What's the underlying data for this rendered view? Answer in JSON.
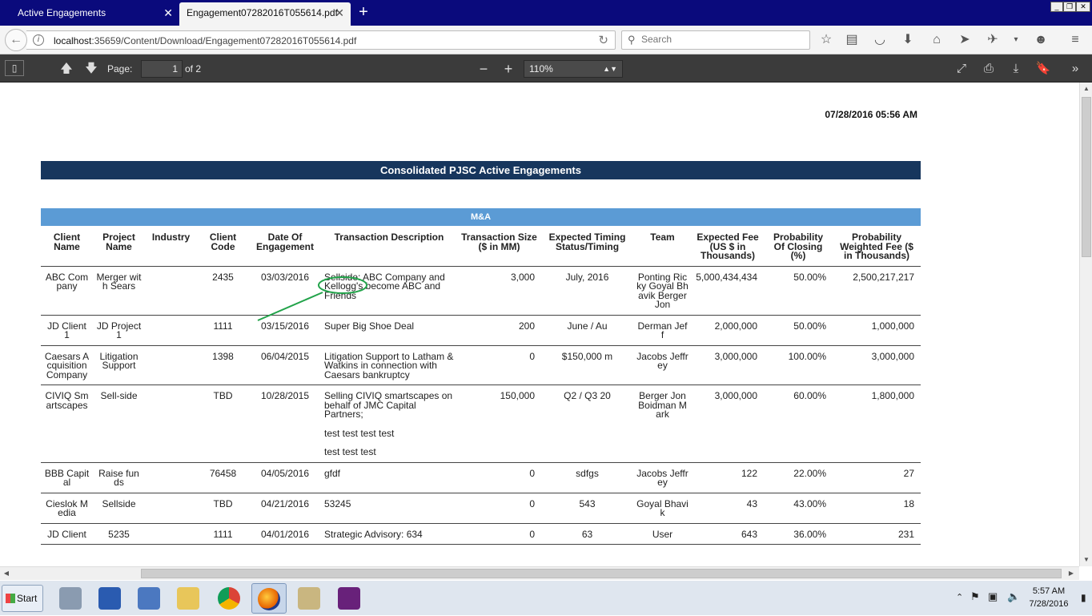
{
  "browser": {
    "tabs": [
      {
        "label": "Active Engagements",
        "active": false
      },
      {
        "label": "Engagement07282016T055614.pdf",
        "active": true
      }
    ],
    "url_host": "localhost",
    "url_rest": ":35659/Content/Download/Engagement07282016T055614.pdf",
    "search_placeholder": "Search"
  },
  "pdf_toolbar": {
    "page_label": "Page:",
    "page_value": "1",
    "page_count": "of 2",
    "zoom": "110%"
  },
  "report": {
    "timestamp": "07/28/2016 05:56 AM",
    "title": "Consolidated PJSC Active Engagements",
    "section": "M&A",
    "columns": [
      "Client Name",
      "Project Name",
      "Industry",
      "Client Code",
      "Date Of Engagement",
      "Transaction Description",
      "Transaction Size ($ in MM)",
      "Expected Timing Status/Timing",
      "Team",
      "Expected Fee (US $ in Thousands)",
      "Probability Of Closing (%)",
      "Probability Weighted Fee ($ in Thousands)"
    ],
    "rows": [
      {
        "client": "ABC Company",
        "project": "Merger with Sears",
        "industry": "",
        "code": "2435",
        "date": "03/03/2016",
        "desc": [
          "Sellside: ABC Company and Kellogg's become ABC and Friends"
        ],
        "size": "3,000",
        "timing": "July, 2016",
        "team": "Ponting Ricky Goyal Bhavik Berger Jon",
        "fee": "5,000,434,434",
        "prob": "50.00%",
        "weighted": "2,500,217,217"
      },
      {
        "client": "JD Client 1",
        "project": "JD Project 1",
        "industry": "",
        "code": "1111",
        "date": "03/15/2016",
        "desc": [
          "Super Big Shoe Deal"
        ],
        "size": "200",
        "timing": "June  / Au",
        "team": "Derman Jeff",
        "fee": "2,000,000",
        "prob": "50.00%",
        "weighted": "1,000,000"
      },
      {
        "client": "Caesars Acquisition Company",
        "project": "Litigation Support",
        "industry": "",
        "code": "1398",
        "date": "06/04/2015",
        "desc": [
          "Litigation Support to Latham & Watkins in connection with Caesars bankruptcy"
        ],
        "size": "0",
        "timing": "$150,000 m",
        "team": "Jacobs Jeffrey",
        "fee": "3,000,000",
        "prob": "100.00%",
        "weighted": "3,000,000"
      },
      {
        "client": "CIVIQ Smartscapes",
        "project": "Sell-side",
        "industry": "",
        "code": "TBD",
        "date": "10/28/2015",
        "desc": [
          "Selling CIVIQ smartscapes on behalf of JMC Capital Partners;",
          "test test test test",
          "test test test"
        ],
        "size": "150,000",
        "timing": "Q2 / Q3 20",
        "team": "Berger Jon Boidman Mark",
        "fee": "3,000,000",
        "prob": "60.00%",
        "weighted": "1,800,000"
      },
      {
        "client": "BBB Capital",
        "project": "Raise funds",
        "industry": "",
        "code": "76458",
        "date": "04/05/2016",
        "desc": [
          "gfdf"
        ],
        "size": "0",
        "timing": "sdfgs",
        "team": "Jacobs Jeffrey",
        "fee": "122",
        "prob": "22.00%",
        "weighted": "27"
      },
      {
        "client": "Cieslok Media",
        "project": "Sellside",
        "industry": "",
        "code": "TBD",
        "date": "04/21/2016",
        "desc": [
          "53245"
        ],
        "size": "0",
        "timing": "543",
        "team": "Goyal Bhavik",
        "fee": "43",
        "prob": "43.00%",
        "weighted": "18"
      },
      {
        "client": "JD Client",
        "project": "5235",
        "industry": "",
        "code": "1111",
        "date": "04/01/2016",
        "desc": [
          "Strategic Advisory: 634"
        ],
        "size": "0",
        "timing": "63",
        "team": "User",
        "fee": "643",
        "prob": "36.00%",
        "weighted": "231"
      }
    ]
  },
  "taskbar": {
    "start_label": "Start",
    "clock_time": "5:57 AM",
    "clock_date": "7/28/2016"
  },
  "colors": {
    "title_bar": "#17365d",
    "section_bar": "#5b9bd5",
    "annotation": "#22a34a"
  }
}
